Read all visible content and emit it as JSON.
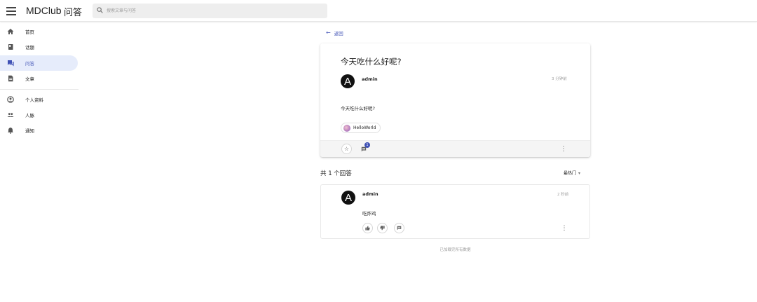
{
  "header": {
    "menu_icon": "menu-icon",
    "logo": "MDClub",
    "section": "问答",
    "search_placeholder": "搜索文章与问答"
  },
  "sidebar": {
    "items": [
      {
        "label": "首页",
        "icon": "home-icon"
      },
      {
        "label": "话题",
        "icon": "book-icon"
      },
      {
        "label": "问答",
        "icon": "forum-icon",
        "active": true
      },
      {
        "label": "文章",
        "icon": "article-icon"
      },
      {
        "label": "个人资料",
        "icon": "account-icon"
      },
      {
        "label": "人脉",
        "icon": "people-icon"
      },
      {
        "label": "通知",
        "icon": "bell-icon"
      }
    ]
  },
  "back": {
    "label": "返回"
  },
  "question": {
    "title": "今天吃什么好呢?",
    "author": "admin",
    "avatar_letter": "A",
    "time": "3 分钟前",
    "body": "今天吃什么好呢?",
    "tag": "HelloWorld",
    "comment_count": "1"
  },
  "answers": {
    "count_label": "共 1 个回答",
    "sort_label": "最热门",
    "items": [
      {
        "author": "admin",
        "avatar_letter": "A",
        "time": "2 秒前",
        "body": "吃炸鸡"
      }
    ]
  },
  "footer": {
    "note": "已加载完所有数据"
  },
  "colors": {
    "accent": "#3f51b5",
    "active_bg": "#e6ecfb"
  }
}
